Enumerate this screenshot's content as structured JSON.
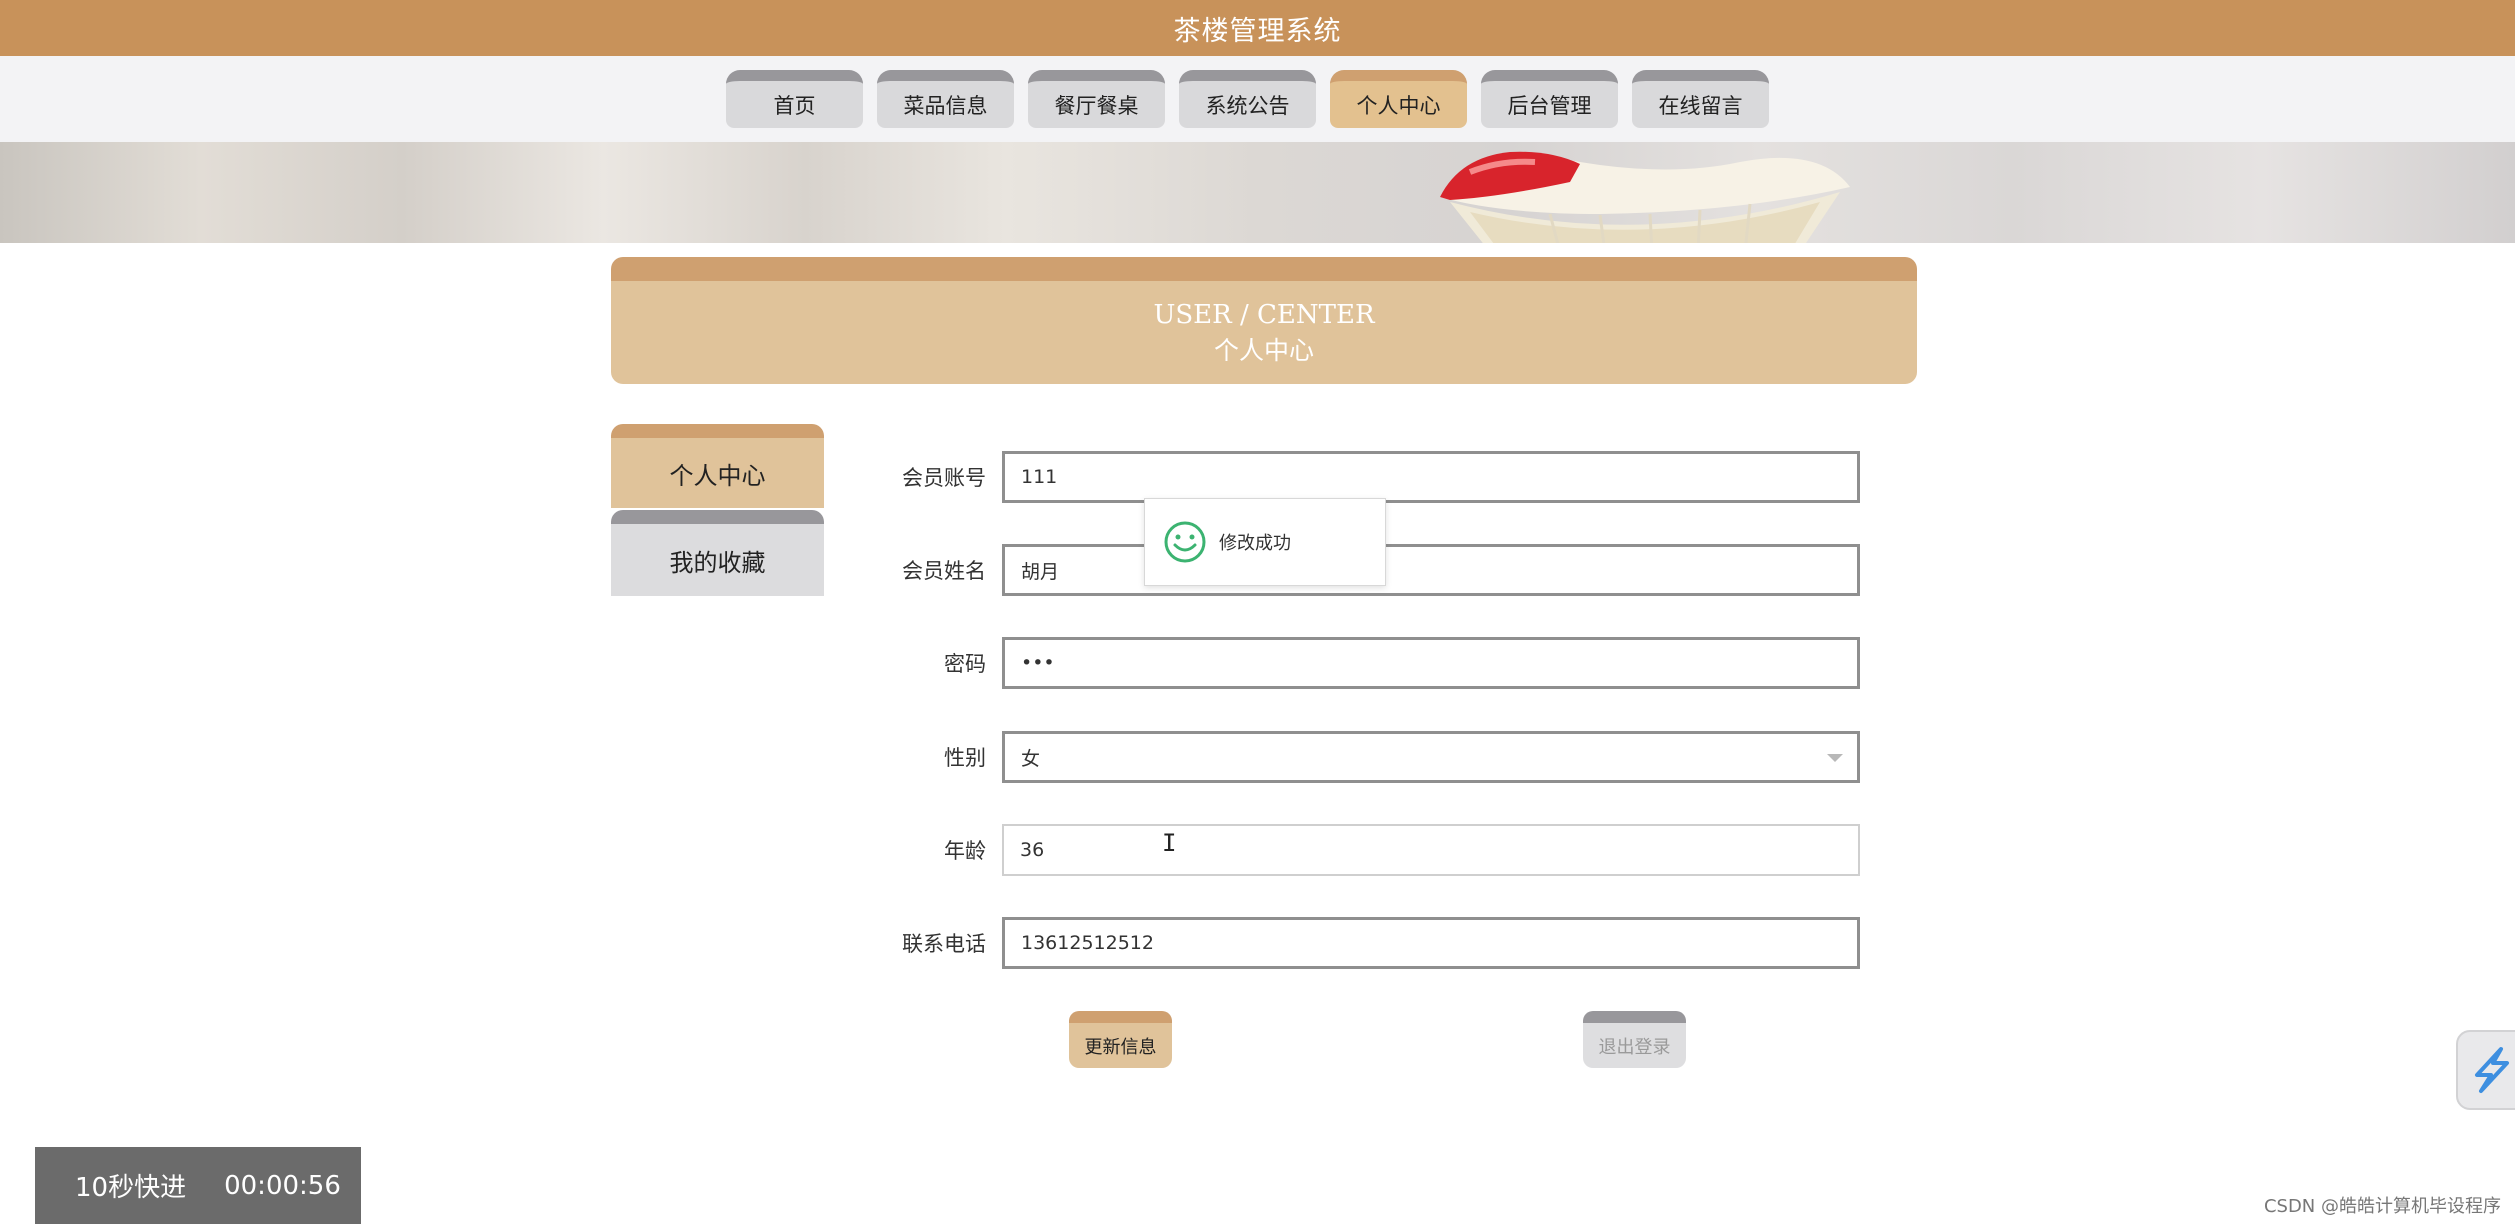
{
  "header": {
    "title": "茶楼管理系统"
  },
  "nav": {
    "items": [
      {
        "label": "首页"
      },
      {
        "label": "菜品信息"
      },
      {
        "label": "餐厅餐桌"
      },
      {
        "label": "系统公告"
      },
      {
        "label": "个人中心"
      },
      {
        "label": "后台管理"
      },
      {
        "label": "在线留言"
      }
    ],
    "active_index": 4
  },
  "user_center": {
    "title_en": "USER / CENTER",
    "title_cn": "个人中心"
  },
  "sidebar": {
    "items": [
      {
        "label": "个人中心"
      },
      {
        "label": "我的收藏"
      }
    ]
  },
  "form": {
    "account": {
      "label": "会员账号",
      "value": "111"
    },
    "name": {
      "label": "会员姓名",
      "value": "胡月"
    },
    "password": {
      "label": "密码",
      "value": "•••"
    },
    "gender": {
      "label": "性别",
      "value": "女"
    },
    "age": {
      "label": "年龄",
      "value": "36"
    },
    "phone": {
      "label": "联系电话",
      "value": "13612512512"
    }
  },
  "buttons": {
    "update": "更新信息",
    "logout": "退出登录"
  },
  "toast": {
    "message": "修改成功"
  },
  "video": {
    "skip_label": "10秒快进",
    "time": "00:00:56"
  },
  "watermark": "CSDN @皓皓计算机毕设程序",
  "colors": {
    "brand": "#c8925a",
    "accent": "#e0c39a",
    "accent_dark": "#cfa070",
    "success": "#3cb371"
  }
}
